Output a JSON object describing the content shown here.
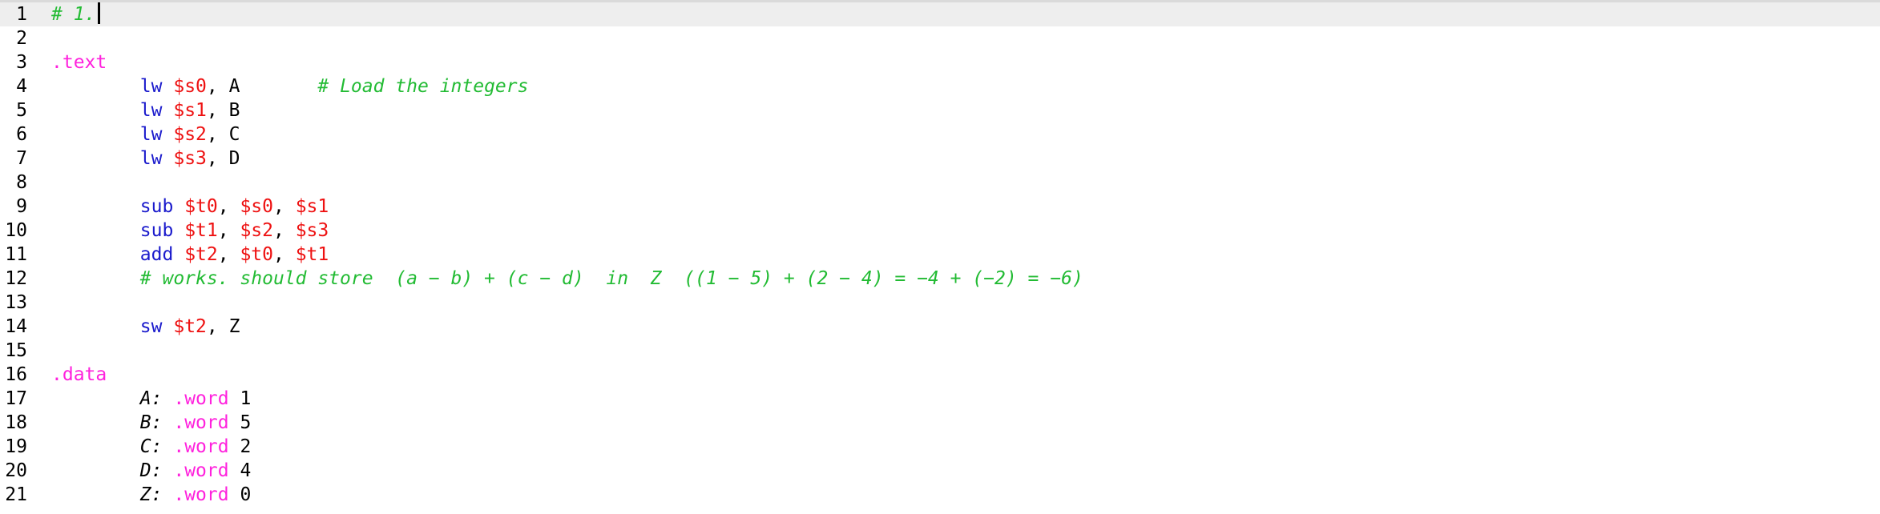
{
  "colors": {
    "comment": "#22bb33",
    "directive": "#ff22dd",
    "instruction": "#1a1acc",
    "register": "#ee1111",
    "text": "#000000",
    "current_line_bg": "#eeeeee"
  },
  "editor": {
    "current_line": 1,
    "lines": [
      {
        "number": "1",
        "tokens": [
          {
            "t": "# 1.",
            "k": "comment"
          }
        ]
      },
      {
        "number": "2",
        "tokens": []
      },
      {
        "number": "3",
        "tokens": [
          {
            "t": ".text",
            "k": "directive"
          }
        ]
      },
      {
        "number": "4",
        "tokens": [
          {
            "t": "        ",
            "k": "plain"
          },
          {
            "t": "lw",
            "k": "instr"
          },
          {
            "t": " ",
            "k": "plain"
          },
          {
            "t": "$s0",
            "k": "reg"
          },
          {
            "t": ", A       ",
            "k": "plain"
          },
          {
            "t": "# Load the integers",
            "k": "comment"
          }
        ]
      },
      {
        "number": "5",
        "tokens": [
          {
            "t": "        ",
            "k": "plain"
          },
          {
            "t": "lw",
            "k": "instr"
          },
          {
            "t": " ",
            "k": "plain"
          },
          {
            "t": "$s1",
            "k": "reg"
          },
          {
            "t": ", B",
            "k": "plain"
          }
        ]
      },
      {
        "number": "6",
        "tokens": [
          {
            "t": "        ",
            "k": "plain"
          },
          {
            "t": "lw",
            "k": "instr"
          },
          {
            "t": " ",
            "k": "plain"
          },
          {
            "t": "$s2",
            "k": "reg"
          },
          {
            "t": ", C",
            "k": "plain"
          }
        ]
      },
      {
        "number": "7",
        "tokens": [
          {
            "t": "        ",
            "k": "plain"
          },
          {
            "t": "lw",
            "k": "instr"
          },
          {
            "t": " ",
            "k": "plain"
          },
          {
            "t": "$s3",
            "k": "reg"
          },
          {
            "t": ", D",
            "k": "plain"
          }
        ]
      },
      {
        "number": "8",
        "tokens": []
      },
      {
        "number": "9",
        "tokens": [
          {
            "t": "        ",
            "k": "plain"
          },
          {
            "t": "sub",
            "k": "instr"
          },
          {
            "t": " ",
            "k": "plain"
          },
          {
            "t": "$t0",
            "k": "reg"
          },
          {
            "t": ", ",
            "k": "plain"
          },
          {
            "t": "$s0",
            "k": "reg"
          },
          {
            "t": ", ",
            "k": "plain"
          },
          {
            "t": "$s1",
            "k": "reg"
          }
        ]
      },
      {
        "number": "10",
        "tokens": [
          {
            "t": "        ",
            "k": "plain"
          },
          {
            "t": "sub",
            "k": "instr"
          },
          {
            "t": " ",
            "k": "plain"
          },
          {
            "t": "$t1",
            "k": "reg"
          },
          {
            "t": ", ",
            "k": "plain"
          },
          {
            "t": "$s2",
            "k": "reg"
          },
          {
            "t": ", ",
            "k": "plain"
          },
          {
            "t": "$s3",
            "k": "reg"
          }
        ]
      },
      {
        "number": "11",
        "tokens": [
          {
            "t": "        ",
            "k": "plain"
          },
          {
            "t": "add",
            "k": "instr"
          },
          {
            "t": " ",
            "k": "plain"
          },
          {
            "t": "$t2",
            "k": "reg"
          },
          {
            "t": ", ",
            "k": "plain"
          },
          {
            "t": "$t0",
            "k": "reg"
          },
          {
            "t": ", ",
            "k": "plain"
          },
          {
            "t": "$t1",
            "k": "reg"
          }
        ]
      },
      {
        "number": "12",
        "tokens": [
          {
            "t": "        ",
            "k": "plain"
          },
          {
            "t": "# works. should store  (a − b) + (c − d)  in  Z  ((1 − 5) + (2 − 4) = −4 + (−2) = −6)",
            "k": "comment"
          }
        ]
      },
      {
        "number": "13",
        "tokens": []
      },
      {
        "number": "14",
        "tokens": [
          {
            "t": "        ",
            "k": "plain"
          },
          {
            "t": "sw",
            "k": "instr"
          },
          {
            "t": " ",
            "k": "plain"
          },
          {
            "t": "$t2",
            "k": "reg"
          },
          {
            "t": ", Z",
            "k": "plain"
          }
        ]
      },
      {
        "number": "15",
        "tokens": []
      },
      {
        "number": "16",
        "tokens": [
          {
            "t": ".data",
            "k": "directive"
          }
        ]
      },
      {
        "number": "17",
        "tokens": [
          {
            "t": "        ",
            "k": "plain"
          },
          {
            "t": "A:",
            "k": "label"
          },
          {
            "t": " ",
            "k": "plain"
          },
          {
            "t": ".word",
            "k": "directive"
          },
          {
            "t": " 1",
            "k": "plain"
          }
        ]
      },
      {
        "number": "18",
        "tokens": [
          {
            "t": "        ",
            "k": "plain"
          },
          {
            "t": "B:",
            "k": "label"
          },
          {
            "t": " ",
            "k": "plain"
          },
          {
            "t": ".word",
            "k": "directive"
          },
          {
            "t": " 5",
            "k": "plain"
          }
        ]
      },
      {
        "number": "19",
        "tokens": [
          {
            "t": "        ",
            "k": "plain"
          },
          {
            "t": "C:",
            "k": "label"
          },
          {
            "t": " ",
            "k": "plain"
          },
          {
            "t": ".word",
            "k": "directive"
          },
          {
            "t": " 2",
            "k": "plain"
          }
        ]
      },
      {
        "number": "20",
        "tokens": [
          {
            "t": "        ",
            "k": "plain"
          },
          {
            "t": "D:",
            "k": "label"
          },
          {
            "t": " ",
            "k": "plain"
          },
          {
            "t": ".word",
            "k": "directive"
          },
          {
            "t": " 4",
            "k": "plain"
          }
        ]
      },
      {
        "number": "21",
        "tokens": [
          {
            "t": "        ",
            "k": "plain"
          },
          {
            "t": "Z:",
            "k": "label"
          },
          {
            "t": " ",
            "k": "plain"
          },
          {
            "t": ".word",
            "k": "directive"
          },
          {
            "t": " 0",
            "k": "plain"
          }
        ]
      }
    ]
  }
}
